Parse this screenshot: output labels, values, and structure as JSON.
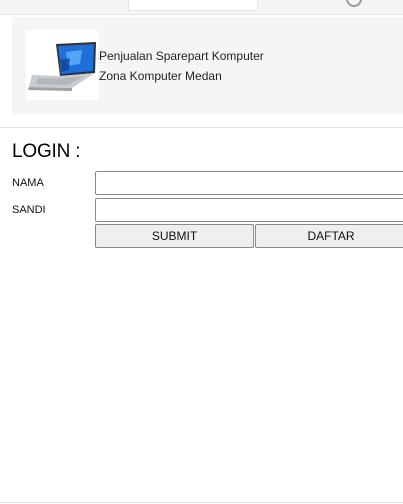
{
  "header": {
    "store_name": "Penjualan Sparepart Komputer",
    "store_location": "Zona Komputer Medan",
    "logo_icon": "laptop-icon"
  },
  "login": {
    "title": "LOGIN :",
    "nama_label": "NAMA",
    "nama_value": "",
    "sandi_label": "SANDI",
    "sandi_value": "",
    "submit_label": "SUBMIT",
    "daftar_label": "DAFTAR"
  }
}
